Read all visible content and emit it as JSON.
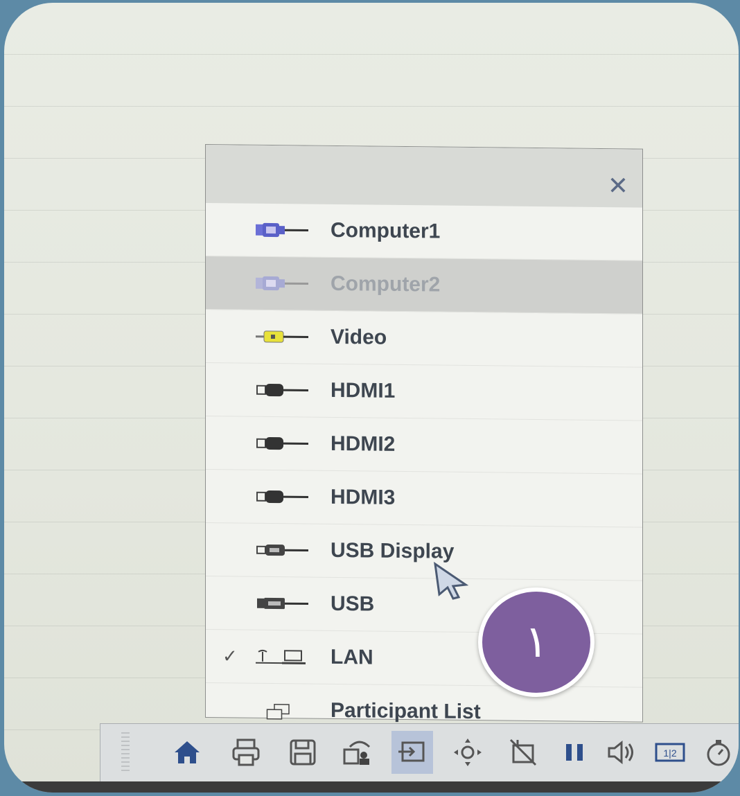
{
  "menu": {
    "close_label": "✕",
    "items": [
      {
        "label": "Computer1",
        "icon": "vga-connector-icon",
        "disabled": false,
        "checked": false
      },
      {
        "label": "Computer2",
        "icon": "vga-connector-icon",
        "disabled": true,
        "checked": false
      },
      {
        "label": "Video",
        "icon": "rca-connector-icon",
        "disabled": false,
        "checked": false
      },
      {
        "label": "HDMI1",
        "icon": "hdmi-connector-icon",
        "disabled": false,
        "checked": false
      },
      {
        "label": "HDMI2",
        "icon": "hdmi-connector-icon",
        "disabled": false,
        "checked": false
      },
      {
        "label": "HDMI3",
        "icon": "hdmi-connector-icon",
        "disabled": false,
        "checked": false
      },
      {
        "label": "USB Display",
        "icon": "usb-display-icon",
        "disabled": false,
        "checked": false
      },
      {
        "label": "USB",
        "icon": "usb-icon",
        "disabled": false,
        "checked": false
      },
      {
        "label": "LAN",
        "icon": "lan-laptop-icon",
        "disabled": false,
        "checked": true,
        "check_mark": "✓"
      },
      {
        "label": "Participant List",
        "icon": "participant-list-icon",
        "disabled": false,
        "checked": false
      }
    ]
  },
  "toolbar": {
    "buttons": [
      {
        "name": "home-icon"
      },
      {
        "name": "print-icon"
      },
      {
        "name": "save-icon"
      },
      {
        "name": "share-screen-icon"
      },
      {
        "name": "source-switch-icon",
        "active": true
      },
      {
        "name": "zoom-move-icon"
      },
      {
        "name": "freeze-off-icon"
      },
      {
        "name": "pause-icon"
      },
      {
        "name": "volume-icon"
      },
      {
        "name": "split-screen-icon",
        "text": "1|2"
      },
      {
        "name": "timer-icon"
      }
    ]
  },
  "badge": {
    "text": "١"
  },
  "colors": {
    "badge_fill": "#7e5f9e",
    "menu_bg": "#f2f3ef",
    "disabled_row": "#cfd0cd",
    "toolbar_active": "#b7c3d9"
  }
}
